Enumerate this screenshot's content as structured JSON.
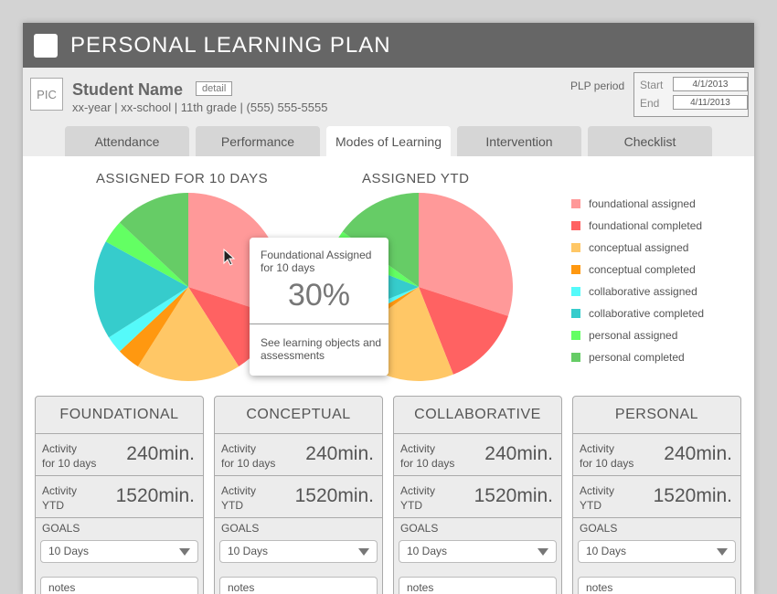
{
  "app": {
    "title": "PERSONAL LEARNING PLAN"
  },
  "student": {
    "pic_label": "PIC",
    "name": "Student Name",
    "detail_label": "detail",
    "info": "xx-year | xx-school | 11th grade | (555) 555-5555"
  },
  "plp": {
    "label": "PLP period",
    "start_label": "Start",
    "start_value": "4/1/2013",
    "end_label": "End",
    "end_value": "4/11/2013"
  },
  "tabs": [
    {
      "label": "Attendance",
      "active": false
    },
    {
      "label": "Performance",
      "active": false
    },
    {
      "label": "Modes of Learning",
      "active": true
    },
    {
      "label": "Intervention",
      "active": false
    },
    {
      "label": "Checklist",
      "active": false
    }
  ],
  "legend": [
    {
      "label": "foundational assigned",
      "color": "#ff9999"
    },
    {
      "label": "foundational completed",
      "color": "#ff6262"
    },
    {
      "label": "conceptual assigned",
      "color": "#ffc766"
    },
    {
      "label": "conceptual completed",
      "color": "#ff9810"
    },
    {
      "label": "collaborative assigned",
      "color": "#55fafa"
    },
    {
      "label": "collaborative completed",
      "color": "#36cccc"
    },
    {
      "label": "personal assigned",
      "color": "#63ff63"
    },
    {
      "label": "personal completed",
      "color": "#66cc66"
    }
  ],
  "chart_data": [
    {
      "type": "pie",
      "title": "ASSIGNED FOR 10 DAYS",
      "categories": [
        "foundational assigned",
        "foundational completed",
        "conceptual assigned",
        "conceptual completed",
        "collaborative assigned",
        "collaborative completed",
        "personal assigned",
        "personal completed"
      ],
      "values": [
        30,
        11,
        18,
        4,
        3,
        17,
        4,
        13
      ]
    },
    {
      "type": "pie",
      "title": "ASSIGNED YTD",
      "categories": [
        "foundational assigned",
        "foundational completed",
        "conceptual assigned",
        "conceptual completed",
        "collaborative assigned",
        "collaborative completed",
        "personal assigned",
        "personal completed"
      ],
      "values": [
        30,
        14,
        21,
        2,
        2,
        12,
        4,
        15
      ]
    }
  ],
  "tooltip": {
    "heading": "Foundational Assigned for 10 days",
    "value": "30%",
    "link": "See learning objects and assessments"
  },
  "panels": [
    {
      "title": "FOUNDATIONAL",
      "activity_10_label_1": "Activity",
      "activity_10_label_2": "for 10 days",
      "activity_10_value": "240min.",
      "activity_ytd_label_1": "Activity",
      "activity_ytd_label_2": "YTD",
      "activity_ytd_value": "1520min.",
      "goals_label": "GOALS",
      "goals_selected": "10 Days",
      "notes_placeholder": "notes"
    },
    {
      "title": "CONCEPTUAL",
      "activity_10_label_1": "Activity",
      "activity_10_label_2": "for 10 days",
      "activity_10_value": "240min.",
      "activity_ytd_label_1": "Activity",
      "activity_ytd_label_2": "YTD",
      "activity_ytd_value": "1520min.",
      "goals_label": "GOALS",
      "goals_selected": "10 Days",
      "notes_placeholder": "notes"
    },
    {
      "title": "COLLABORATIVE",
      "activity_10_label_1": "Activity",
      "activity_10_label_2": "for 10 days",
      "activity_10_value": "240min.",
      "activity_ytd_label_1": "Activity",
      "activity_ytd_label_2": "YTD",
      "activity_ytd_value": "1520min.",
      "goals_label": "GOALS",
      "goals_selected": "10 Days",
      "notes_placeholder": "notes"
    },
    {
      "title": "PERSONAL",
      "activity_10_label_1": "Activity",
      "activity_10_label_2": "for 10 days",
      "activity_10_value": "240min.",
      "activity_ytd_label_1": "Activity",
      "activity_ytd_label_2": "YTD",
      "activity_ytd_value": "1520min.",
      "goals_label": "GOALS",
      "goals_selected": "10 Days",
      "notes_placeholder": "notes"
    }
  ],
  "icons": {
    "cursor": "mouse-pointer-icon",
    "dropdown": "chevron-down-icon",
    "app": "app-logo-icon"
  }
}
